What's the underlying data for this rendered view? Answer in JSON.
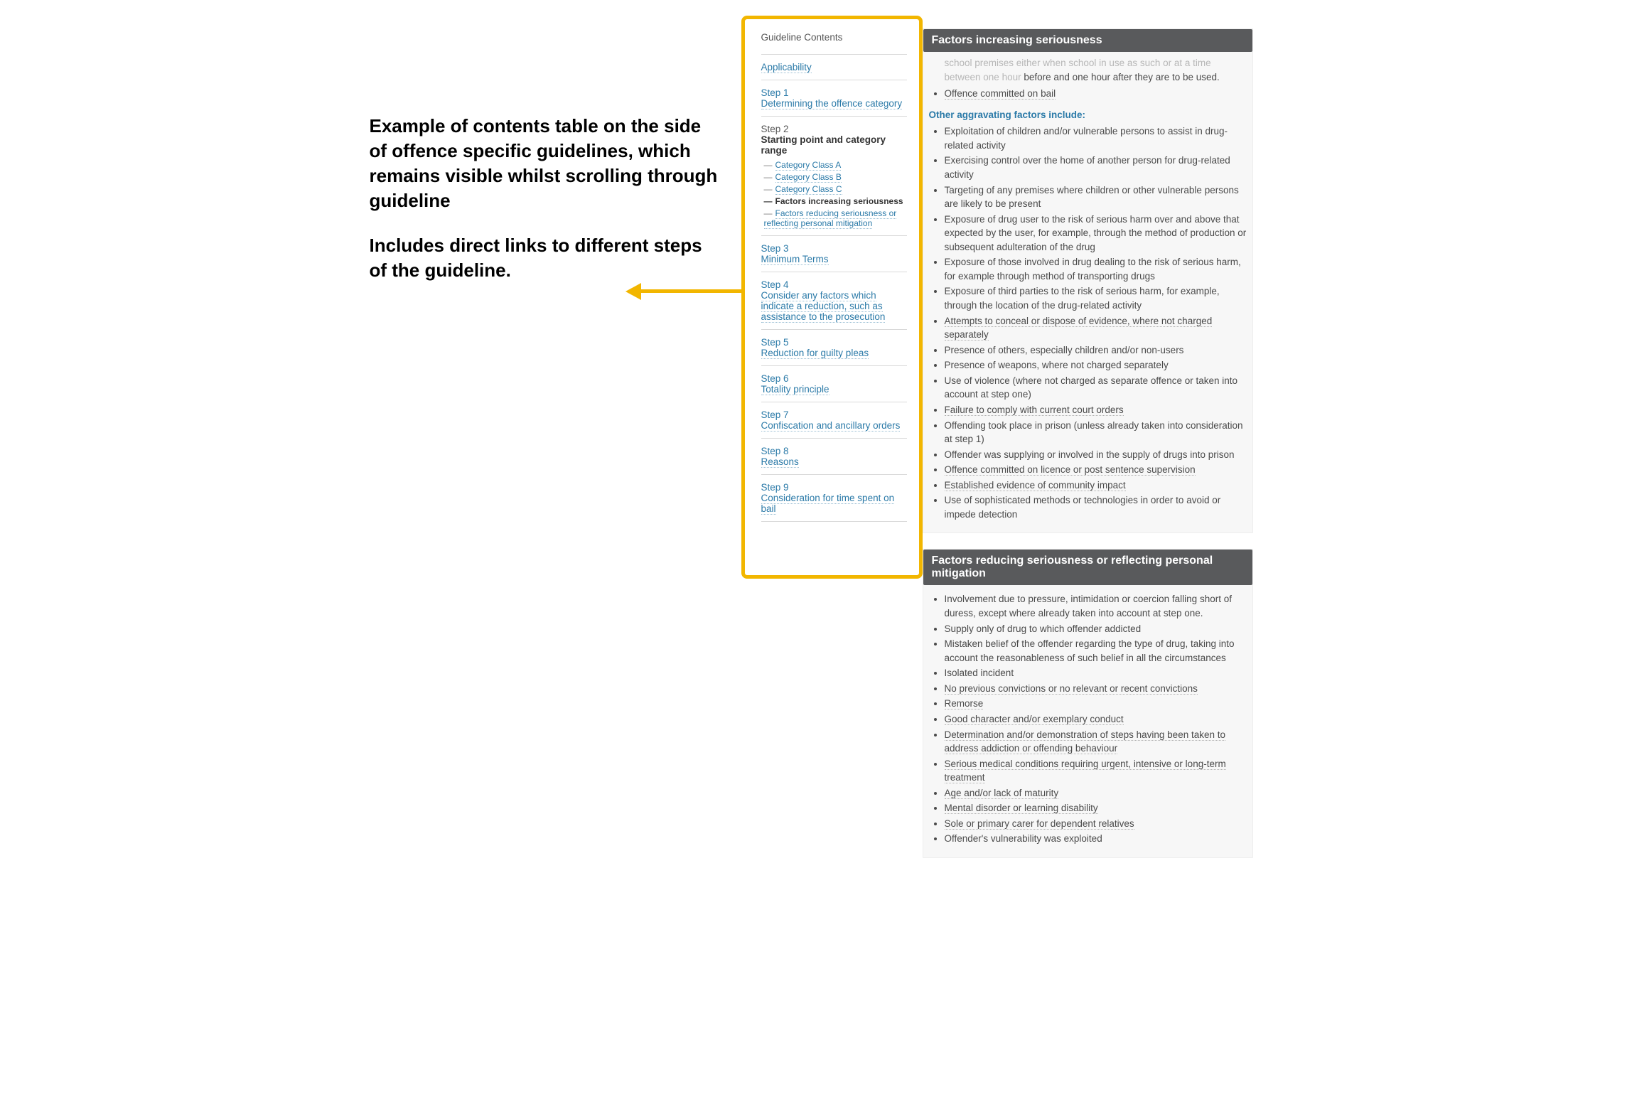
{
  "explain": {
    "p1": "Example of contents table on the side of offence specific guidelines, which remains visible whilst scrolling through guideline",
    "p2": "Includes direct links to different steps of the guideline."
  },
  "nav": {
    "title": "Guideline Contents",
    "applicability": "Applicability",
    "steps": [
      {
        "n": "Step 1",
        "t": "Determining the offence category"
      },
      {
        "n": "Step 2",
        "t": "Starting point and category range",
        "current": true,
        "subs": [
          {
            "t": "Category Class A"
          },
          {
            "t": "Category Class B"
          },
          {
            "t": "Category Class C"
          },
          {
            "t": "Factors increasing seriousness",
            "current": true
          },
          {
            "t": "Factors reducing seriousness or reflecting personal mitigation"
          }
        ]
      },
      {
        "n": "Step 3",
        "t": "Minimum Terms"
      },
      {
        "n": "Step 4",
        "t": "Consider any factors which indicate a reduction, such as assistance to the prosecution"
      },
      {
        "n": "Step 5",
        "t": "Reduction for guilty pleas"
      },
      {
        "n": "Step 6",
        "t": "Totality principle"
      },
      {
        "n": "Step 7",
        "t": "Confiscation and ancillary orders"
      },
      {
        "n": "Step 8",
        "t": "Reasons"
      },
      {
        "n": "Step 9",
        "t": "Consideration for time spent on bail"
      }
    ]
  },
  "panel1": {
    "title": "Factors increasing seriousness",
    "preamble_faded": "school premises either when school in use as such or at a time between one hour",
    "preamble_rest": "before and one hour after they are to be used.",
    "prelist": [
      "Offence committed on bail"
    ],
    "subhead": "Other aggravating factors include:",
    "items": [
      "Exploitation of children and/or vulnerable persons to assist in drug-related activity",
      "Exercising control over the home of another person for drug-related activity",
      "Targeting of any premises where children or other vulnerable persons are likely to be present",
      "Exposure of drug user to the risk of serious harm over and above that expected by the user, for example, through the method of production or subsequent adulteration of the drug",
      "Exposure of those involved in drug dealing to the risk of serious harm, for example through method of transporting drugs",
      "Exposure of third parties to the risk of serious harm, for example, through the location of the drug-related activity",
      "Attempts to conceal or dispose of evidence, where not charged separately",
      "Presence of others, especially children and/or non-users",
      "Presence of weapons, where not charged separately",
      "Use of violence (where not charged as separate offence or taken into account at step one)",
      "Failure to comply with current court orders",
      "Offending took place in prison (unless already taken into consideration at step 1)",
      "Offender was supplying or involved in the supply of drugs into prison",
      "Offence committed on licence or post sentence supervision",
      "Established evidence of community impact",
      "Use of sophisticated methods or technologies in order to avoid or impede detection"
    ],
    "dotted_idx": [
      6,
      10,
      13,
      14
    ]
  },
  "panel2": {
    "title": "Factors reducing seriousness or reflecting personal mitigation",
    "items": [
      "Involvement due to pressure, intimidation or coercion falling short of duress, except where already taken into account at step one.",
      "Supply only of drug to which offender addicted",
      "Mistaken belief of the offender regarding the type of drug, taking into account the reasonableness of such belief in all the circumstances",
      "Isolated incident",
      "No previous convictions or no relevant or recent convictions",
      "Remorse",
      "Good character and/or exemplary conduct",
      "Determination and/or demonstration of steps having been taken to address addiction or offending behaviour",
      "Serious medical conditions requiring urgent, intensive or long-term treatment",
      "Age and/or lack of maturity",
      "Mental disorder or learning disability",
      "Sole or primary carer for dependent relatives",
      "Offender's vulnerability was exploited"
    ],
    "dotted_idx": [
      4,
      5,
      6,
      7,
      8,
      9,
      10,
      11
    ]
  }
}
